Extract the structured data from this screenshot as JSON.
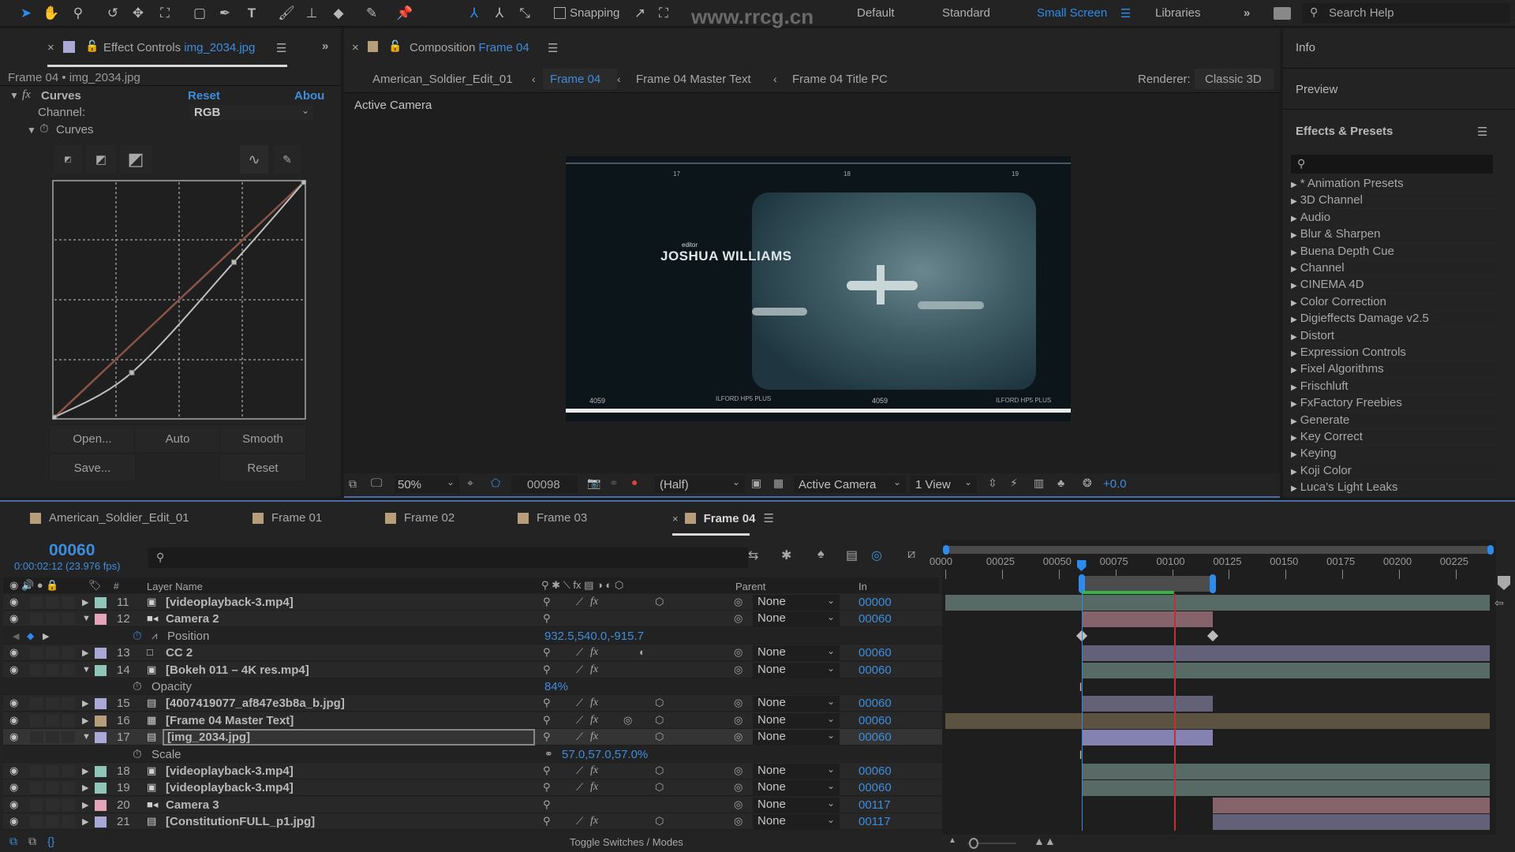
{
  "toolbar": {
    "tools": [
      "selection-tool",
      "hand-tool",
      "zoom-tool",
      "rotation-tool",
      "camera-orbit-tool",
      "pan-behind-tool",
      "rectangle-tool",
      "pen-tool",
      "type-tool",
      "brush-tool",
      "clone-stamp-tool",
      "eraser-tool",
      "roto-brush-tool",
      "puppet-pin-tool"
    ],
    "snapping_label": "Snapping",
    "workspaces": [
      "Default",
      "Standard",
      "Small Screen",
      "Libraries"
    ],
    "active_workspace": "Small Screen",
    "search_placeholder": "Search Help",
    "watermark": "www.rrcg.cn"
  },
  "effect_controls": {
    "tab_title": "Effect Controls",
    "tab_file": "img_2034.jpg",
    "layer_path": "Frame 04 • img_2034.jpg",
    "effect_name": "Curves",
    "reset_label": "Reset",
    "about_label": "Abou",
    "channel_label": "Channel:",
    "channel_value": "RGB",
    "curves_prop_label": "Curves",
    "buttons": {
      "open": "Open...",
      "auto": "Auto",
      "smooth": "Smooth",
      "save": "Save...",
      "reset": "Reset"
    },
    "curve_points": [
      [
        0,
        0
      ],
      [
        0.31,
        0.19
      ],
      [
        0.72,
        0.66
      ],
      [
        1,
        1
      ]
    ]
  },
  "composition": {
    "tab_title": "Composition",
    "tab_comp": "Frame 04",
    "breadcrumbs": [
      "American_Soldier_Edit_01",
      "Frame 04",
      "Frame 04 Master Text",
      "Frame 04 Title PC"
    ],
    "active_breadcrumb": "Frame 04",
    "renderer_label": "Renderer:",
    "renderer_value": "Classic 3D",
    "view_label": "Active Camera",
    "frame_text": {
      "role": "editor",
      "name": "JOSHUA WILLIAMS",
      "edge_numbers": [
        "17",
        "18",
        "19"
      ],
      "edge_codes": [
        "4059",
        "ILFORD HP5 PLUS",
        "4059",
        "ILFORD HP5 PLUS"
      ]
    },
    "footer": {
      "zoom": "50%",
      "timecode": "00098",
      "resolution": "(Half)",
      "camera": "Active Camera",
      "views": "1 View",
      "exposure": "+0.0"
    }
  },
  "right_panel": {
    "info_label": "Info",
    "preview_label": "Preview",
    "effects_title": "Effects & Presets",
    "effects": [
      "* Animation Presets",
      "3D Channel",
      "Audio",
      "Blur & Sharpen",
      "Buena Depth Cue",
      "Channel",
      "CINEMA 4D",
      "Color Correction",
      "Digieffects Damage v2.5",
      "Distort",
      "Expression Controls",
      "Fixel Algorithms",
      "Frischluft",
      "FxFactory Freebies",
      "Generate",
      "Key Correct",
      "Keying",
      "Koji Color",
      "Luca's Light Leaks"
    ]
  },
  "timeline": {
    "tabs": [
      "American_Soldier_Edit_01",
      "Frame 01",
      "Frame 02",
      "Frame 03",
      "Frame 04"
    ],
    "active_tab": "Frame 04",
    "current_frame": "00060",
    "current_timecode": "0:00:02:12 (23.976 fps)",
    "columns": {
      "num": "#",
      "layer_name": "Layer Name",
      "parent": "Parent",
      "in": "In"
    },
    "ruler_labels": [
      "0000",
      "00025",
      "00050",
      "00075",
      "00100",
      "00125",
      "00150",
      "00175",
      "00200",
      "00225"
    ],
    "ruler_range": [
      0,
      240
    ],
    "work_area": [
      60,
      118
    ],
    "rendered_to": 101,
    "playhead_frame": 60,
    "red_marker_frame": 101,
    "toggle_label": "Toggle Switches / Modes",
    "layers": [
      {
        "num": "11",
        "name": "[videoplayback-3.mp4]",
        "color": "#8fc6b8",
        "type": "video",
        "expanded": false,
        "parent": "None",
        "in": "00000",
        "bar": [
          0,
          240
        ],
        "barcolor": "#5b6f6a"
      },
      {
        "num": "12",
        "name": "Camera 2",
        "color": "#e3a6b8",
        "type": "camera",
        "expanded": true,
        "parent": "None",
        "in": "00060",
        "bar": [
          60,
          118
        ],
        "barcolor": "#8c6670"
      },
      {
        "prop": "Position",
        "value": "932.5,540.0,-915.7",
        "keyframes": [
          60,
          118
        ]
      },
      {
        "num": "13",
        "name": "CC 2",
        "color": "#a9a8d6",
        "type": "solid",
        "expanded": false,
        "parent": "None",
        "in": "00060",
        "bar": [
          60,
          240
        ],
        "barcolor": "#66657c"
      },
      {
        "num": "14",
        "name": "[Bokeh 011 – 4K res.mp4]",
        "color": "#8fc6b8",
        "type": "video",
        "expanded": true,
        "parent": "None",
        "in": "00060",
        "bar": [
          60,
          240
        ],
        "barcolor": "#5b6f6a"
      },
      {
        "prop": "Opacity",
        "value": "84%"
      },
      {
        "num": "15",
        "name": "[4007419077_af847e3b8a_b.jpg]",
        "color": "#a9a8d6",
        "type": "image",
        "expanded": false,
        "parent": "None",
        "in": "00060",
        "bar": [
          60,
          118
        ],
        "barcolor": "#66657c"
      },
      {
        "num": "16",
        "name": "[Frame 04 Master Text]",
        "color": "#b69e7a",
        "type": "comp",
        "expanded": false,
        "parent": "None",
        "in": "00060",
        "bar": [
          0,
          240
        ],
        "barcolor": "#5f5545"
      },
      {
        "num": "17",
        "name": "[img_2034.jpg]",
        "color": "#a9a8d6",
        "type": "image",
        "expanded": true,
        "selected": true,
        "parent": "None",
        "in": "00060",
        "bar": [
          60,
          118
        ],
        "barcolor": "#8a88b8"
      },
      {
        "prop": "Scale",
        "value": "57.0,57.0,57.0%"
      },
      {
        "num": "18",
        "name": "[videoplayback-3.mp4]",
        "color": "#8fc6b8",
        "type": "video",
        "expanded": false,
        "parent": "None",
        "in": "00060",
        "bar": [
          60,
          240
        ],
        "barcolor": "#5b6f6a"
      },
      {
        "num": "19",
        "name": "[videoplayback-3.mp4]",
        "color": "#8fc6b8",
        "type": "video",
        "expanded": false,
        "parent": "None",
        "in": "00060",
        "bar": [
          60,
          240
        ],
        "barcolor": "#5b6f6a"
      },
      {
        "num": "20",
        "name": "Camera 3",
        "color": "#e3a6b8",
        "type": "camera",
        "expanded": false,
        "parent": "None",
        "in": "00117",
        "bar": [
          118,
          240
        ],
        "barcolor": "#8c6670"
      },
      {
        "num": "21",
        "name": "[ConstitutionFULL_p1.jpg]",
        "color": "#a9a8d6",
        "type": "image",
        "expanded": false,
        "parent": "None",
        "in": "00117",
        "bar": [
          118,
          240
        ],
        "barcolor": "#66657c"
      }
    ]
  }
}
